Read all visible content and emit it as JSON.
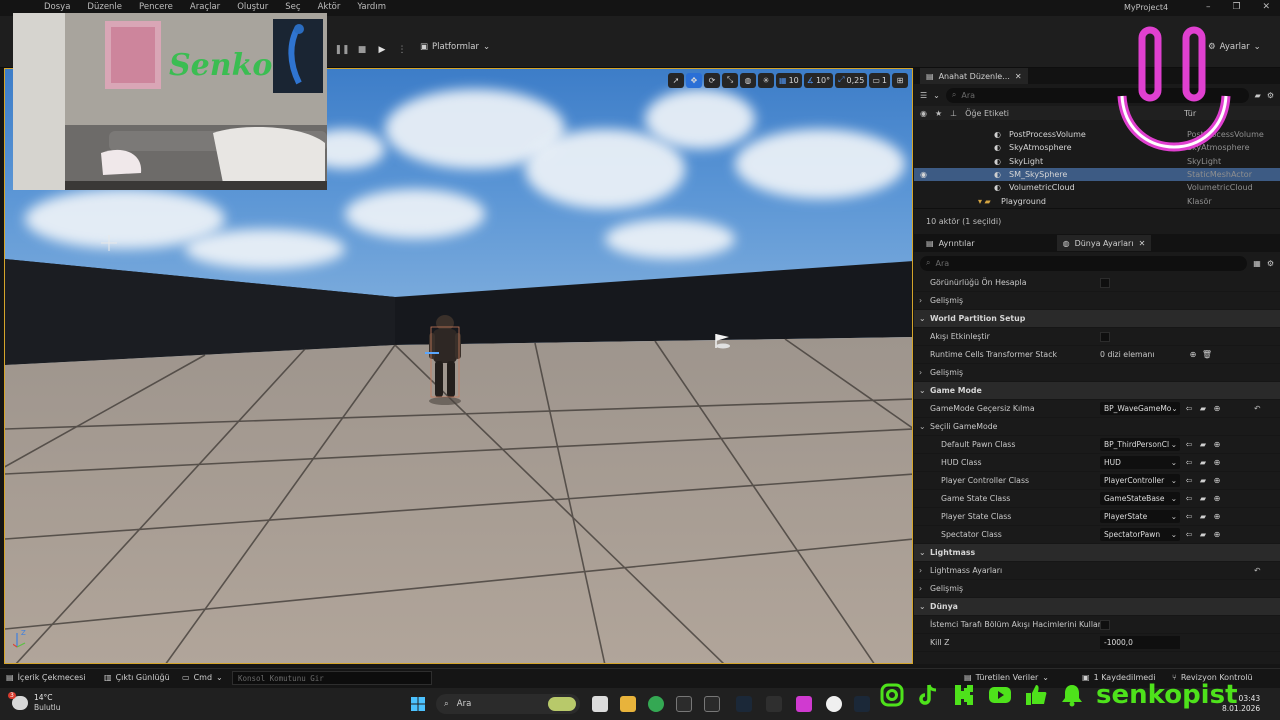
{
  "menu": {
    "items": [
      "Dosya",
      "Düzenle",
      "Pencere",
      "Araçlar",
      "Oluştur",
      "Seç",
      "Aktör",
      "Yardım"
    ],
    "project_title": "MyProject4"
  },
  "toolbar": {
    "platform_label": "Platformlar",
    "settings_label": "Ayarlar"
  },
  "viewport": {
    "grid_snap": "10",
    "angle_snap": "10°",
    "scale_snap": "0,25",
    "camera_speed": "1",
    "axis_z": "Z"
  },
  "outliner": {
    "tab_label": "Anahat Düzenle...",
    "search_placeholder": "Ara",
    "col_label": "Öğe Etiketi",
    "col_type": "Tür",
    "rows": [
      {
        "name": "PostProcessVolume",
        "type": "PostProcessVolume"
      },
      {
        "name": "SkyAtmosphere",
        "type": "SkyAtmosphere"
      },
      {
        "name": "SkyLight",
        "type": "SkyLight"
      },
      {
        "name": "SM_SkySphere",
        "type": "StaticMeshActor"
      },
      {
        "name": "VolumetricCloud",
        "type": "VolumetricCloud"
      },
      {
        "name": "Playground",
        "type": "Klasör"
      }
    ],
    "footer": "10 aktör (1 seçildi)"
  },
  "details": {
    "tab_details": "Ayrıntılar",
    "tab_world": "Dünya Ayarları",
    "search_placeholder": "Ara",
    "rows": [
      {
        "kind": "prop",
        "label": "Görünürlüğü Ön Hesapla",
        "value_type": "check"
      },
      {
        "kind": "sub",
        "label": "Gelişmiş"
      },
      {
        "kind": "cat",
        "label": "World Partition Setup"
      },
      {
        "kind": "prop",
        "label": "Akışı Etkinleştir",
        "value_type": "check"
      },
      {
        "kind": "prop",
        "label": "Runtime Cells Transformer Stack",
        "value_type": "array",
        "value": "0 dizi elemanı"
      },
      {
        "kind": "sub",
        "label": "Gelişmiş"
      },
      {
        "kind": "cat",
        "label": "Game Mode"
      },
      {
        "kind": "prop",
        "label": "GameMode Geçersiz Kılma",
        "value_type": "drop",
        "value": "BP_WaveGameMo"
      },
      {
        "kind": "subcat",
        "label": "Seçili GameMode"
      },
      {
        "kind": "prop2",
        "label": "Default Pawn Class",
        "value_type": "drop",
        "value": "BP_ThirdPersonCl"
      },
      {
        "kind": "prop2",
        "label": "HUD Class",
        "value_type": "drop",
        "value": "HUD"
      },
      {
        "kind": "prop2",
        "label": "Player Controller Class",
        "value_type": "drop",
        "value": "PlayerController"
      },
      {
        "kind": "prop2",
        "label": "Game State Class",
        "value_type": "drop",
        "value": "GameStateBase"
      },
      {
        "kind": "prop2",
        "label": "Player State Class",
        "value_type": "drop",
        "value": "PlayerState"
      },
      {
        "kind": "prop2",
        "label": "Spectator Class",
        "value_type": "drop",
        "value": "SpectatorPawn"
      },
      {
        "kind": "cat",
        "label": "Lightmass"
      },
      {
        "kind": "sub",
        "label": "Lightmass Ayarları"
      },
      {
        "kind": "sub",
        "label": "Gelişmiş"
      },
      {
        "kind": "cat",
        "label": "Dünya"
      },
      {
        "kind": "prop",
        "label": "İstemci Tarafı Bölüm Akışı Hacimlerini Kullan",
        "value_type": "check"
      },
      {
        "kind": "prop",
        "label": "Kill Z",
        "value_type": "num",
        "value": "-1000,0"
      }
    ]
  },
  "statusbar": {
    "content_drawer": "İçerik Çekmecesi",
    "output_log": "Çıktı Günlüğü",
    "cmd": "Cmd",
    "console_placeholder": "Konsol Komutunu Gir",
    "derived_data": "Türetilen Veriler",
    "unsaved": "1 Kaydedilmedi",
    "revision": "Revizyon Kontrolü"
  },
  "taskbar": {
    "temperature": "14°C",
    "weather": "Bulutlu",
    "search_label": "Ara",
    "time": "03:43",
    "date": "8.01.2026",
    "notif_count": "3"
  },
  "webcam": {
    "wall_text": "Senko"
  },
  "social": {
    "handle": "senkopist",
    "color": "#4ee21b"
  },
  "colors": {
    "selection": "#3d5b84",
    "viewport_border": "#d4a42a",
    "accent_blue": "#2a6fd6",
    "smiley": "#e040d0"
  }
}
